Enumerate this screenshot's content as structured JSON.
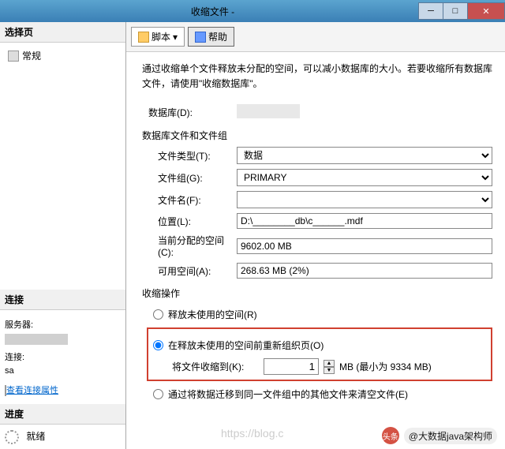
{
  "window": {
    "title": "收缩文件 -"
  },
  "left": {
    "select_header": "选择页",
    "general": "常规",
    "conn_header": "连接",
    "server_label": "服务器:",
    "conn_label": "连接:",
    "conn_value": "sa",
    "view_props": "查看连接属性",
    "prog_header": "进度",
    "ready": "就绪"
  },
  "toolbar": {
    "script": "脚本",
    "help": "帮助"
  },
  "main": {
    "desc": "通过收缩单个文件释放未分配的空间，可以减小数据库的大小。若要收缩所有数据库文件，请使用\"收缩数据库\"。",
    "db_label": "数据库(D):",
    "files_title": "数据库文件和文件组",
    "file_type_label": "文件类型(T):",
    "file_type_value": "数据",
    "filegroup_label": "文件组(G):",
    "filegroup_value": "PRIMARY",
    "filename_label": "文件名(F):",
    "filename_value": "",
    "location_label": "位置(L):",
    "location_value": "D:\\________db\\c______.mdf",
    "allocated_label": "当前分配的空间(C):",
    "allocated_value": "9602.00 MB",
    "available_label": "可用空间(A):",
    "available_value": "268.63 MB (2%)",
    "shrink_title": "收缩操作",
    "opt_release": "释放未使用的空间(R)",
    "opt_reorg": "在释放未使用的空间前重新组织页(O)",
    "shrink_to_label": "将文件收缩到(K):",
    "shrink_to_value": "1",
    "shrink_min": "MB (最小为 9334 MB)",
    "opt_migrate": "通过将数据迁移到同一文件组中的其他文件来清空文件(E)"
  },
  "watermark": {
    "url": "https://blog.c",
    "author": "@大数据java架构师"
  }
}
